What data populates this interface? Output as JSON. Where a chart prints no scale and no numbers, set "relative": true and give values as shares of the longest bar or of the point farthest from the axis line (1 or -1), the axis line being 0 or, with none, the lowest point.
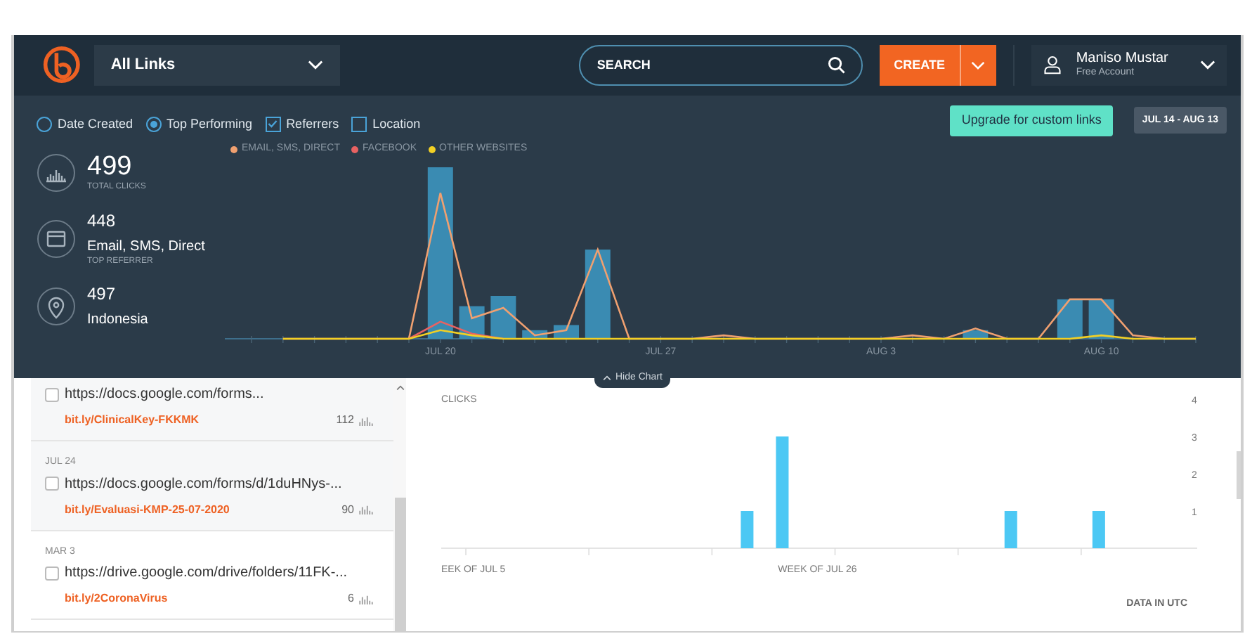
{
  "header": {
    "links_dropdown": {
      "value": "All Links"
    },
    "search": {
      "placeholder": "SEARCH"
    },
    "create_button": "CREATE",
    "user": {
      "name": "Maniso Mustar",
      "account": "Free Account"
    }
  },
  "filters": [
    {
      "kind": "radio",
      "label": "Date Created",
      "selected": false
    },
    {
      "kind": "radio",
      "label": "Top Performing",
      "selected": true
    },
    {
      "kind": "checkbox",
      "label": "Referrers",
      "checked": true
    },
    {
      "kind": "checkbox",
      "label": "Location",
      "checked": false
    }
  ],
  "upgrade_button": "Upgrade for custom links",
  "date_range": "JUL 14 - AUG 13",
  "stats": [
    {
      "kind": "clicks",
      "value": "499",
      "label": "TOTAL CLICKS"
    },
    {
      "kind": "referrer",
      "value": "448",
      "name": "Email, SMS, Direct",
      "label": "TOP REFERRER"
    },
    {
      "kind": "location",
      "value": "497",
      "name": "Indonesia"
    }
  ],
  "timeline": {
    "chart_data": {
      "type": "bar",
      "relative": true,
      "categories": [
        null,
        null,
        null,
        null,
        null,
        null,
        "JUL 20",
        null,
        null,
        null,
        null,
        null,
        null,
        "JUL 27",
        null,
        null,
        null,
        null,
        null,
        null,
        "AUG 3",
        null,
        null,
        null,
        null,
        null,
        null,
        "AUG 10",
        null,
        null,
        null
      ],
      "series": [
        {
          "type": "bar",
          "color": "#3a8bb2",
          "values": [
            0,
            0,
            0,
            0,
            0,
            0,
            1,
            0.19,
            0.25,
            0.05,
            0.08,
            0.52,
            0,
            0,
            0,
            0,
            0,
            0,
            0,
            0,
            0,
            0,
            0,
            0.05,
            0,
            0,
            0.23,
            0.23,
            0,
            0,
            0
          ]
        },
        {
          "type": "line",
          "name": "EMAIL, SMS, DIRECT",
          "color": "#f0a070",
          "values": [
            null,
            0,
            0,
            0,
            0,
            0,
            0.85,
            0.12,
            0.18,
            0.02,
            0.05,
            0.52,
            0,
            0,
            0,
            0.02,
            0,
            0,
            0,
            0,
            0,
            0.02,
            0,
            0.06,
            0,
            0,
            0.23,
            0.23,
            0.02,
            0,
            0
          ]
        },
        {
          "type": "line",
          "name": "FACEBOOK",
          "color": "#e86262",
          "values": [
            null,
            null,
            null,
            null,
            null,
            0,
            0.1,
            0.03,
            0,
            null,
            null,
            null,
            null,
            null,
            null,
            null,
            null,
            null,
            null,
            null,
            null,
            null,
            null,
            null,
            null,
            null,
            null,
            null,
            null,
            null,
            null
          ]
        },
        {
          "type": "line",
          "name": "OTHER WEBSITES",
          "color": "#f2d024",
          "values": [
            null,
            0,
            0,
            0,
            0,
            0,
            0.05,
            0.02,
            0,
            0,
            0,
            0,
            0,
            0,
            0,
            0,
            0,
            0,
            0,
            0,
            0,
            0,
            0,
            0,
            0,
            0,
            0,
            0.02,
            0,
            0,
            0
          ]
        }
      ]
    }
  },
  "hide_chart": "Hide Chart",
  "links": [
    {
      "url": "https://docs.google.com/forms...",
      "short": "bit.ly/ClinicalKey-FKKMK",
      "clicks": "112",
      "checked": false
    },
    {
      "date": "JUL 24",
      "url": "https://docs.google.com/forms/d/1duHNys-...",
      "short": "bit.ly/Evaluasi-KMP-25-07-2020",
      "clicks": "90",
      "checked": false
    },
    {
      "date": "MAR 3",
      "url": "https://drive.google.com/drive/folders/11FK-...",
      "short": "bit.ly/2CoronaVirus",
      "clicks": "6",
      "checked": false
    }
  ],
  "link_chart": {
    "chart_data": {
      "type": "bar",
      "ylabel": "CLICKS",
      "categories": [
        null,
        "EEK OF JUL 5",
        null,
        null,
        null,
        null,
        null,
        null,
        null,
        null,
        null,
        null,
        null,
        null,
        null,
        null,
        null,
        null,
        null,
        null,
        null,
        "WEEK OF JUL 26",
        null,
        null,
        null,
        null,
        null,
        null,
        null,
        null,
        null,
        null,
        null,
        null,
        null,
        null,
        null,
        null,
        null,
        null,
        null,
        null,
        null
      ],
      "values": [
        null,
        null,
        null,
        null,
        null,
        null,
        null,
        null,
        null,
        null,
        null,
        null,
        null,
        null,
        null,
        null,
        null,
        1,
        null,
        3,
        null,
        null,
        null,
        null,
        null,
        null,
        null,
        null,
        null,
        null,
        null,
        null,
        1,
        null,
        null,
        null,
        null,
        1,
        null,
        null,
        null,
        null,
        null
      ],
      "ylim": [
        0,
        4
      ],
      "yticks": [
        1,
        2,
        3,
        4
      ]
    }
  },
  "data_note": "DATA IN UTC"
}
